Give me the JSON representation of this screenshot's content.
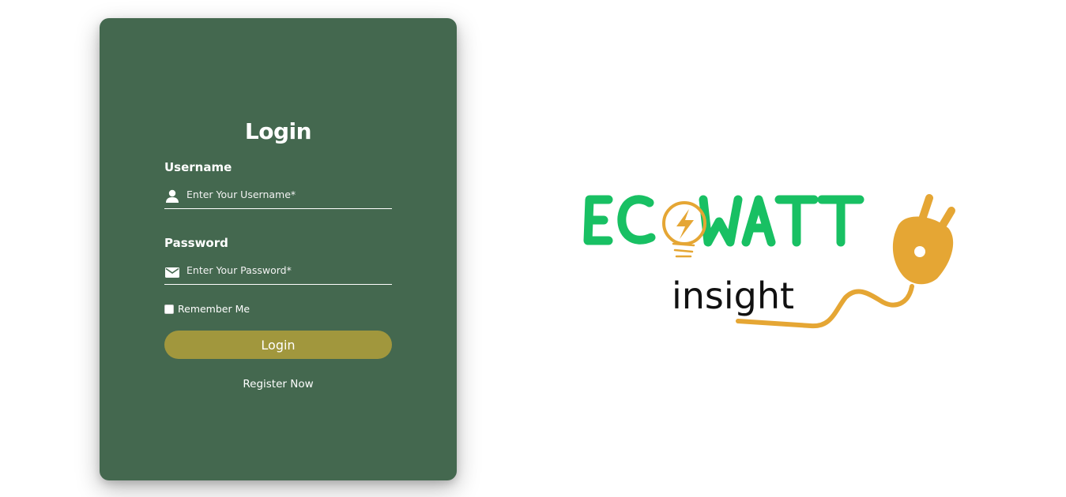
{
  "login": {
    "title": "Login",
    "username": {
      "label": "Username",
      "placeholder": "Enter Your Username*",
      "icon": "user-icon"
    },
    "password": {
      "label": "Password",
      "placeholder": "Enter Your Password*",
      "icon": "envelope-icon"
    },
    "remember_label": "Remember Me",
    "remember_checked": false,
    "submit_label": "Login",
    "register_label": "Register Now"
  },
  "logo": {
    "brand_text": "ECOWATT",
    "tagline": "insight"
  },
  "colors": {
    "card_background": "#44684f",
    "button_background": "#a1973d",
    "logo_green": "#18c063",
    "logo_orange": "#e5a634"
  }
}
